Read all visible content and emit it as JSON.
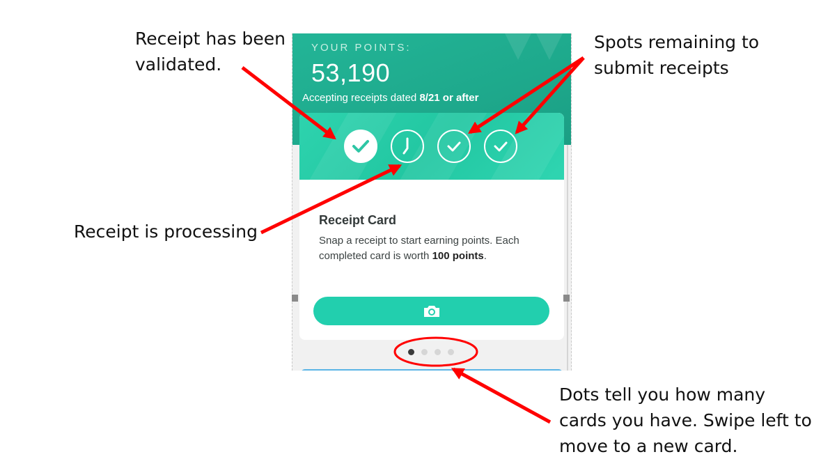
{
  "annotations": {
    "validated": "Receipt has been validated.",
    "spots": "Spots remaining to submit receipts",
    "processing": "Receipt is processing",
    "dots": "Dots tell you how many cards you have. Swipe left to move to a new card."
  },
  "header": {
    "points_label": "YOUR POINTS:",
    "points_value": "53,190",
    "accept_prefix": "Accepting receipts dated ",
    "accept_date": "8/21 or after"
  },
  "card": {
    "title": "Receipt Card",
    "description_prefix": "Snap a receipt to start earning points. Each completed card is worth ",
    "description_bold": "100 points",
    "description_suffix": ".",
    "spots": [
      {
        "state": "validated",
        "icon": "check-icon"
      },
      {
        "state": "processing",
        "icon": "clock-icon"
      },
      {
        "state": "open",
        "icon": "check-icon"
      },
      {
        "state": "open",
        "icon": "check-icon"
      }
    ],
    "button_icon": "camera-icon"
  },
  "pagination": {
    "total": 4,
    "active": 1
  },
  "colors": {
    "header_bg": "#1ea98c",
    "card_top_bg": "#2ed3ae",
    "button_bg": "#22cfae",
    "arrow_red": "#ff0000",
    "active_dot": "#3a3a3a"
  }
}
